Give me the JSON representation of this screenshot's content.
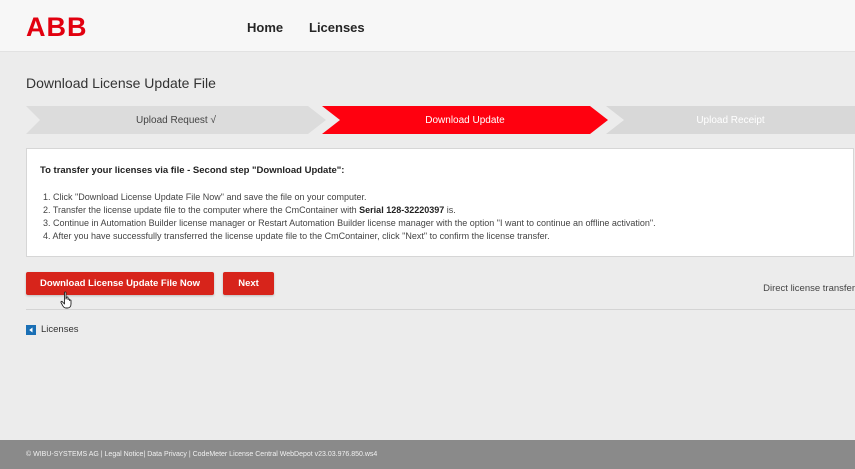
{
  "header": {
    "logo_text": "ABB",
    "nav": [
      "Home",
      "Licenses"
    ]
  },
  "page": {
    "title": "Download License Update File"
  },
  "steps": [
    {
      "label": "Upload Request √",
      "state": "done"
    },
    {
      "label": "Download Update",
      "state": "active"
    },
    {
      "label": "Upload Receipt",
      "state": "pending"
    }
  ],
  "instructions": {
    "heading": "To transfer your licenses via file - Second step \"Download Update\":",
    "item1": "1. Click \"Download License Update File Now\" and save the file on your computer.",
    "item2_prefix": "2. Transfer the license update file to the computer where the CmContainer with ",
    "item2_serial": "Serial 128-32220397",
    "item2_suffix": " is.",
    "item3": "3. Continue in Automation Builder license manager or Restart Automation Builder license manager with the option \"I want to continue an offline activation\".",
    "item4": "4. After you have successfully transferred the license update file to the CmContainer, click \"Next\" to confirm the license transfer."
  },
  "actions": {
    "download_label": "Download License Update File Now",
    "next_label": "Next",
    "direct_transfer_label": "Direct license transfer"
  },
  "back_link": {
    "label": "Licenses"
  },
  "footer": {
    "text": "© WIBU-SYSTEMS AG | Legal Notice| Data Privacy | CodeMeter License Central WebDepot v23.03.976.850.ws4"
  },
  "colors": {
    "brand_red": "#e2000f",
    "active_step": "#ff000f",
    "button_red": "#d7241b",
    "link_icon_blue": "#1a6fb5"
  }
}
